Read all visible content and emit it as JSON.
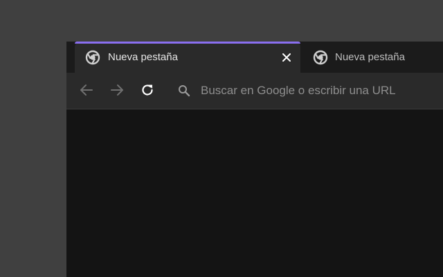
{
  "tabs": [
    {
      "title": "Nueva pestaña",
      "active": true,
      "favicon": "chrome-icon",
      "close_icon": "close-icon"
    },
    {
      "title": "Nueva pestaña",
      "active": false,
      "favicon": "chrome-icon"
    }
  ],
  "toolbar": {
    "back_icon": "arrow-left-icon",
    "forward_icon": "arrow-right-icon",
    "reload_icon": "reload-icon"
  },
  "omnibox": {
    "placeholder": "Buscar en Google o escribir una URL",
    "icon": "search-icon"
  },
  "colors": {
    "accent": "#8a6ff0",
    "tab_active_bg": "#2a2a2a",
    "content_bg": "#141414",
    "desktop_bg": "#404040"
  }
}
